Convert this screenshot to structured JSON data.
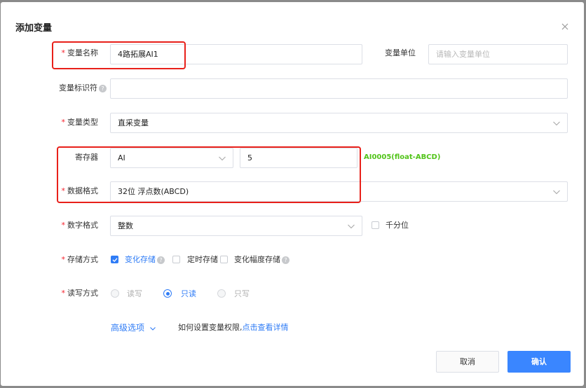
{
  "dialog": {
    "title": "添加变量"
  },
  "fields": {
    "var_name": {
      "label": "变量名称",
      "value": "4路拓展AI1"
    },
    "var_unit": {
      "label": "变量单位",
      "placeholder": "请输入变量单位"
    },
    "var_id": {
      "label": "变量标识符",
      "help": "?",
      "value": ""
    },
    "var_type": {
      "label": "变量类型",
      "value": "直采变量"
    },
    "register": {
      "label": "寄存器",
      "type_value": "AI",
      "address_value": "5",
      "hint": "AI0005(float-ABCD)"
    },
    "data_format": {
      "label": "数据格式",
      "value": "32位 浮点数(ABCD)"
    },
    "number_format": {
      "label": "数字格式",
      "value": "整数",
      "thousands_label": "千分位"
    },
    "storage": {
      "label": "存储方式",
      "options": [
        "变化存储",
        "定时存储",
        "变化幅度存储"
      ],
      "help": "?"
    },
    "rw": {
      "label": "读写方式",
      "options": [
        "读写",
        "只读",
        "只写"
      ],
      "selected": "只读"
    }
  },
  "advanced": {
    "label": "高级选项",
    "tip": "如何设置变量权限,",
    "link": "点击查看详情"
  },
  "buttons": {
    "cancel": "取消",
    "confirm": "确认"
  },
  "colors": {
    "accent": "#2f7cf6",
    "required": "#f5222d",
    "hint": "#52c41a",
    "highlight": "#e8201a"
  }
}
